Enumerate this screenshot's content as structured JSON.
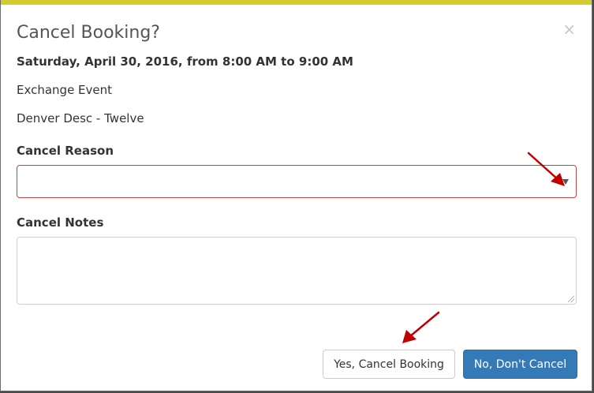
{
  "colors": {
    "top_bar": "#d4cc2e",
    "select_border": "#b94a48",
    "primary_button": "#337ab7",
    "annotation_arrow": "#c00000"
  },
  "modal": {
    "title": "Cancel Booking?",
    "close_icon": "×",
    "date_line": "Saturday, April 30, 2016, from 8:00 AM to 9:00 AM",
    "event_name": "Exchange Event",
    "room_name": "Denver Desc - Twelve",
    "cancel_reason_label": "Cancel Reason",
    "cancel_reason_value": "",
    "cancel_notes_label": "Cancel Notes",
    "cancel_notes_value": "",
    "yes_button_label": "Yes, Cancel Booking",
    "no_button_label": "No, Don't Cancel"
  },
  "icons": {
    "close": "close-icon",
    "dropdown": "chevron-down-icon",
    "resize": "resize-handle-icon",
    "annotation": "arrow-icon"
  }
}
